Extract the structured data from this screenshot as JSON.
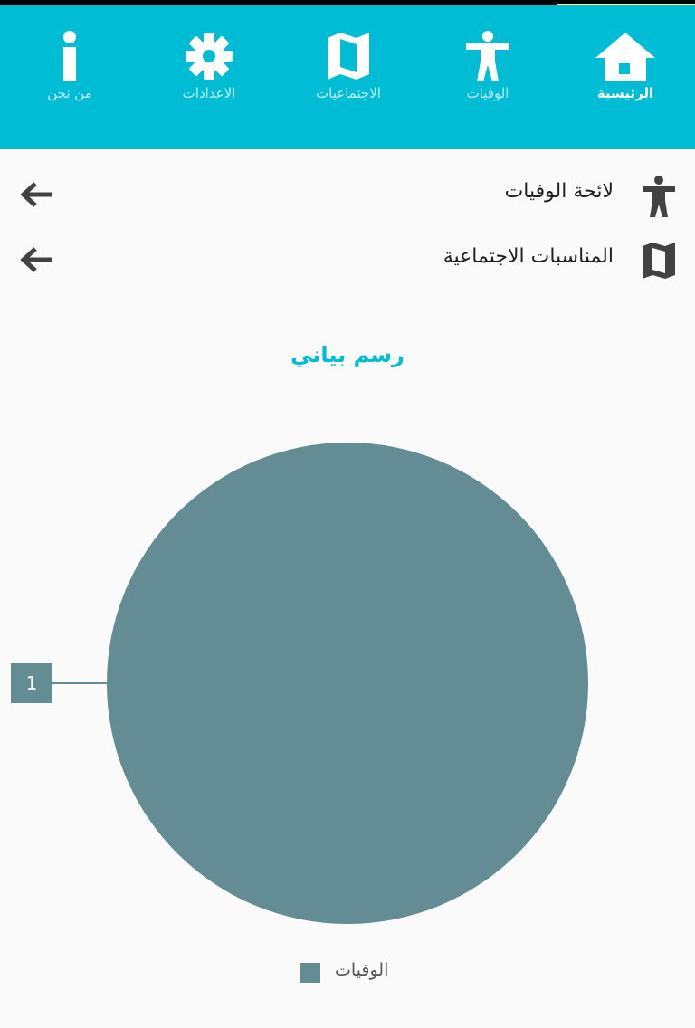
{
  "nav": {
    "items": [
      {
        "label": "الرئيسية",
        "icon": "home-icon",
        "active": true
      },
      {
        "label": "الوفيات",
        "icon": "accessibility-icon",
        "active": false
      },
      {
        "label": "الاجتماعيات",
        "icon": "map-icon",
        "active": false
      },
      {
        "label": "الاعدادات",
        "icon": "gear-icon",
        "active": false
      },
      {
        "label": "من نحن",
        "icon": "info-icon",
        "active": false
      }
    ]
  },
  "menu": {
    "items": [
      {
        "label": "لائحة الوفيات",
        "icon": "accessibility-icon",
        "arrow": "arrow-left-icon"
      },
      {
        "label": "المناسبات الاجتماعية",
        "icon": "map-icon",
        "arrow": "arrow-left-icon"
      }
    ]
  },
  "colors": {
    "primary": "#00bcd4",
    "status_accent": "#fff59d",
    "pie_slice": "#638c94",
    "icon_dark": "#424242",
    "background": "#fafafa"
  },
  "chart_data": {
    "type": "pie",
    "title": "رسم بياني",
    "categories": [
      "الوفيات"
    ],
    "values": [
      1
    ],
    "data_labels": [
      "1"
    ],
    "legend": [
      "الوفيات"
    ],
    "legend_position": "bottom",
    "colors": [
      "#638c94"
    ]
  }
}
